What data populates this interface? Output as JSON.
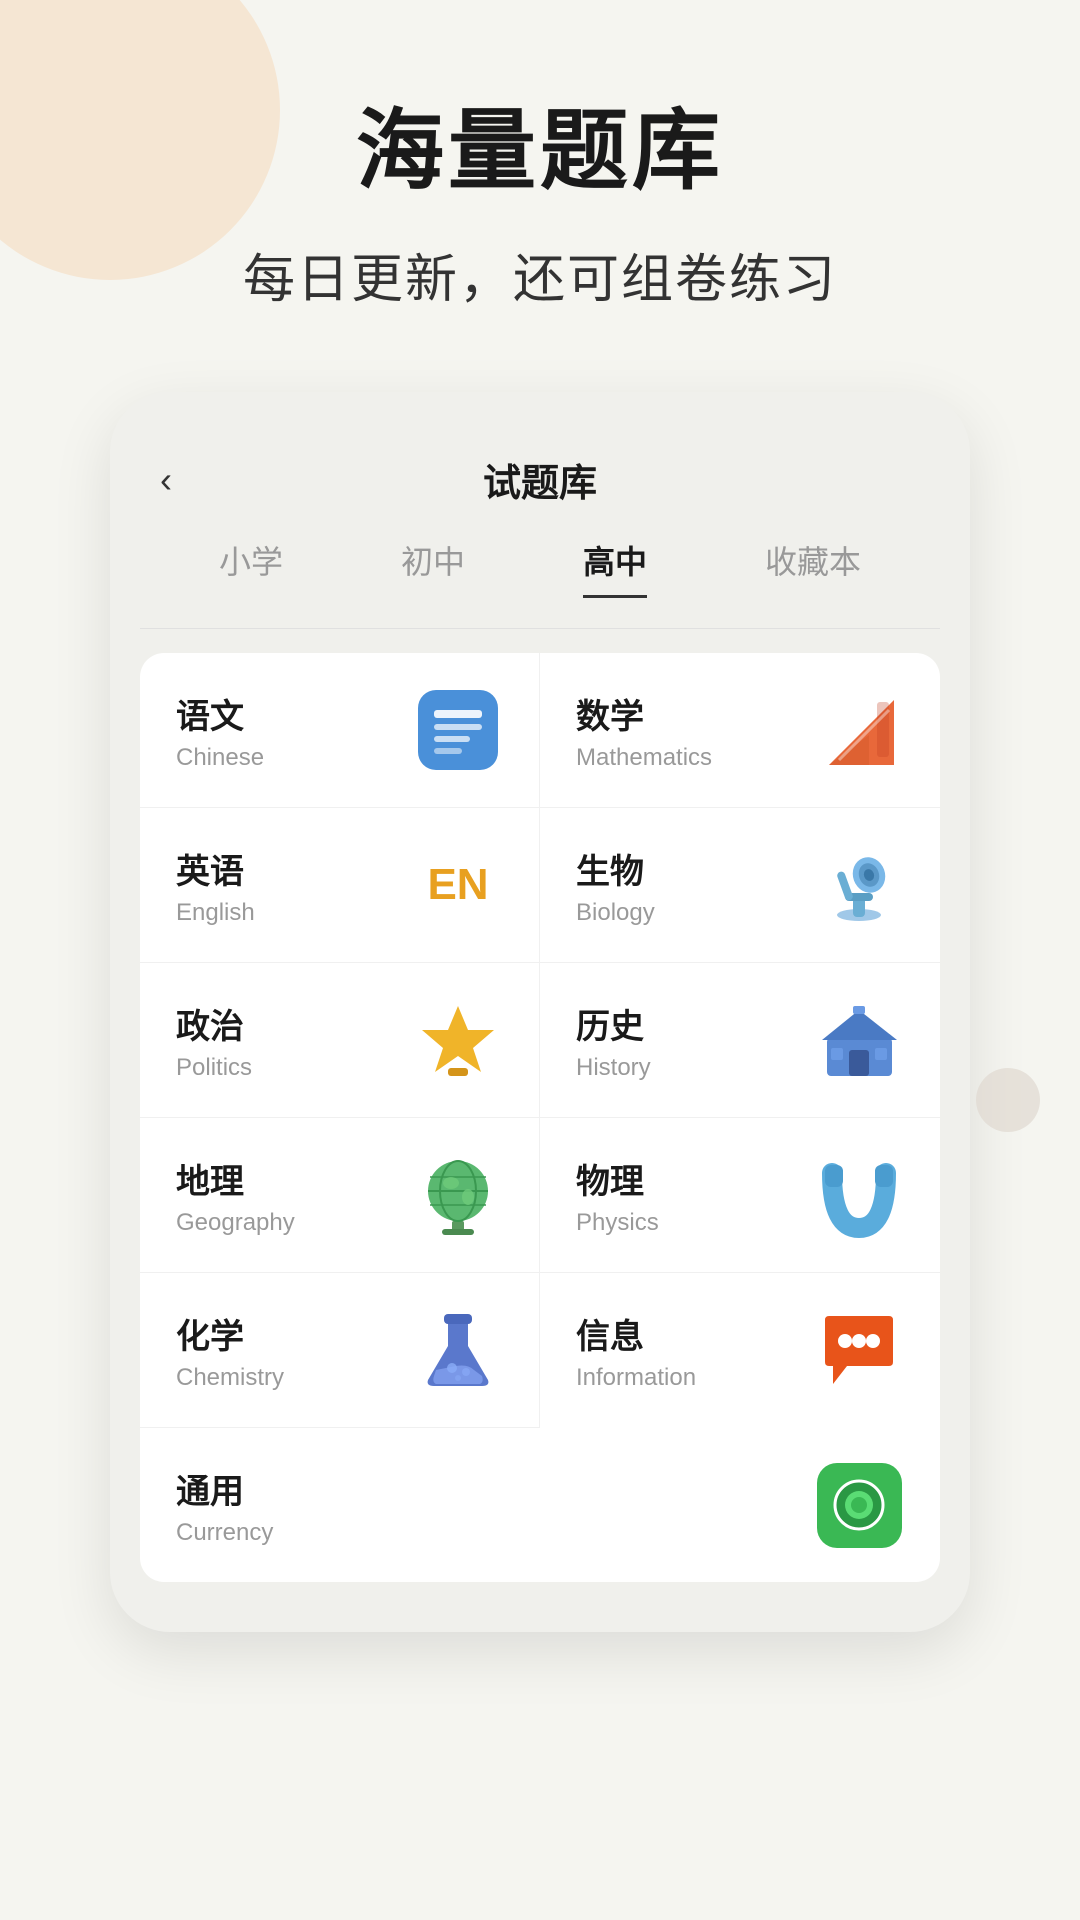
{
  "background": {
    "decor_color": "#f5e6d3"
  },
  "hero": {
    "main_title": "海量题库",
    "sub_title": "每日更新，还可组卷练习"
  },
  "app": {
    "header": {
      "back_label": "‹",
      "title": "试题库"
    },
    "tabs": [
      {
        "id": "primary",
        "label": "小学",
        "active": false
      },
      {
        "id": "middle",
        "label": "初中",
        "active": false
      },
      {
        "id": "high",
        "label": "高中",
        "active": true
      },
      {
        "id": "favorites",
        "label": "收藏本",
        "active": false
      }
    ],
    "subjects": [
      {
        "id": "chinese",
        "zh": "语文",
        "en": "Chinese",
        "icon": "chinese"
      },
      {
        "id": "math",
        "zh": "数学",
        "en": "Mathematics",
        "icon": "math"
      },
      {
        "id": "english",
        "zh": "英语",
        "en": "English",
        "icon": "english"
      },
      {
        "id": "biology",
        "zh": "生物",
        "en": "Biology",
        "icon": "biology"
      },
      {
        "id": "politics",
        "zh": "政治",
        "en": "Politics",
        "icon": "politics"
      },
      {
        "id": "history",
        "zh": "历史",
        "en": "History",
        "icon": "history"
      },
      {
        "id": "geography",
        "zh": "地理",
        "en": "Geography",
        "icon": "geography"
      },
      {
        "id": "physics",
        "zh": "物理",
        "en": "Physics",
        "icon": "physics"
      },
      {
        "id": "chemistry",
        "zh": "化学",
        "en": "Chemistry",
        "icon": "chemistry"
      },
      {
        "id": "information",
        "zh": "信息",
        "en": "Information",
        "icon": "information"
      },
      {
        "id": "currency",
        "zh": "通用",
        "en": "Currency",
        "icon": "currency"
      }
    ]
  }
}
